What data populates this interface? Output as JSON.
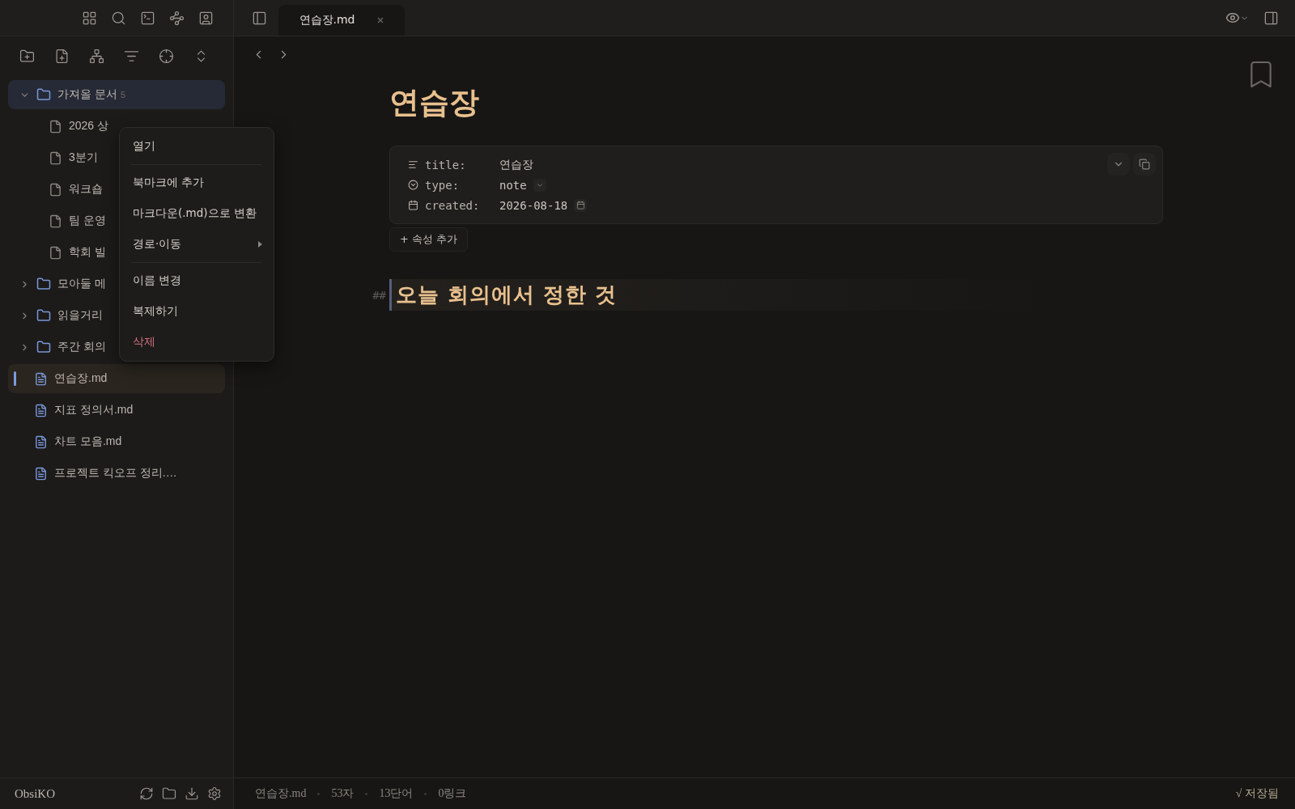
{
  "tabs": [
    {
      "label": "연습장.md",
      "selected": true
    }
  ],
  "tree": [
    {
      "kind": "folder",
      "label": "가져올 문서",
      "count": "5",
      "expanded": true,
      "selected": true,
      "children": [
        {
          "kind": "file",
          "label": "2026 상",
          "selected": false
        },
        {
          "kind": "file",
          "label": "3분기",
          "selected": false
        },
        {
          "kind": "file",
          "label": "워크숍",
          "selected": false
        },
        {
          "kind": "file",
          "label": "팀 운영",
          "selected": false
        },
        {
          "kind": "file",
          "label": "학회 빌",
          "selected": false
        }
      ]
    },
    {
      "kind": "folder",
      "label": "모아둘 메",
      "expanded": false,
      "selected": false
    },
    {
      "kind": "folder",
      "label": "읽을거리",
      "expanded": false,
      "selected": false
    },
    {
      "kind": "folder",
      "label": "주간 회의",
      "expanded": false,
      "selected": false
    },
    {
      "kind": "note",
      "label": "연습장.md",
      "selected": true
    },
    {
      "kind": "note",
      "label": "지표 정의서.md",
      "selected": false
    },
    {
      "kind": "note",
      "label": "차트 모음.md",
      "selected": false
    },
    {
      "kind": "note",
      "label": "프로젝트 킥오프 정리.…",
      "selected": false
    }
  ],
  "context_menu": [
    {
      "kind": "item",
      "label": "열기"
    },
    {
      "kind": "separator"
    },
    {
      "kind": "item",
      "label": "북마크에 추가"
    },
    {
      "kind": "item",
      "label": "마크다운(.md)으로 변환"
    },
    {
      "kind": "submenu",
      "label": "경로·이동"
    },
    {
      "kind": "separator"
    },
    {
      "kind": "item",
      "label": "이름 변경"
    },
    {
      "kind": "item",
      "label": "복제하기"
    },
    {
      "kind": "danger",
      "label": "삭제"
    }
  ],
  "note": {
    "title": "연습장",
    "properties": [
      {
        "kind": "text",
        "key": "title:",
        "value": "연습장"
      },
      {
        "kind": "select",
        "key": "type:",
        "value": "note"
      },
      {
        "kind": "date",
        "key": "created:",
        "value": "2026-08-18"
      }
    ],
    "add_property": "+ 속성 추가",
    "heading_marker": "##",
    "heading": "오늘 회의에서 정한 것"
  },
  "status_bar": {
    "vault": "ObsiKO",
    "file": "연습장.md",
    "chars": "53자",
    "words": "13단어",
    "links": "0링크",
    "saved": "√ 저장됨"
  }
}
